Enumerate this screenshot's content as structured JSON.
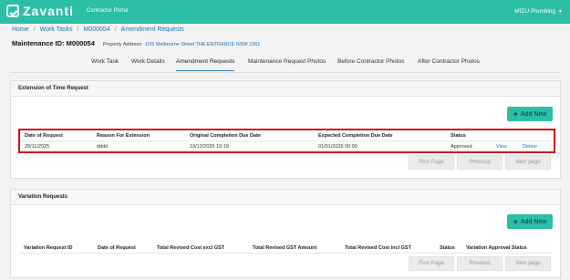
{
  "app": {
    "logo_text": "Zavanti",
    "portal_label": "Contractor Portal",
    "organisation": "MIZU Plumbing"
  },
  "breadcrumb": [
    "Home",
    "Work Tasks",
    "M000054",
    "Amendment Requests"
  ],
  "header": {
    "maintenance_id": "Maintenance ID: M000054",
    "address_label": "Property Address:",
    "address_value": "1/26 Melbourne Street THE ENTRANCE NSW 2261"
  },
  "tabs": [
    {
      "label": "Work Task",
      "active": false
    },
    {
      "label": "Work Details",
      "active": false
    },
    {
      "label": "Amendment Requests",
      "active": true
    },
    {
      "label": "Maintenance Request Photos",
      "active": false
    },
    {
      "label": "Before Contractor Photos",
      "active": false
    },
    {
      "label": "After Contractor Photos",
      "active": false
    }
  ],
  "extension": {
    "title": "Extension of Time Request",
    "add_label": "Add New",
    "columns": [
      "Date of Request",
      "Reason For Extension",
      "Original Completion Due Date",
      "Expected Completion Due Date",
      "Status"
    ],
    "rows": [
      {
        "date": "28/11/2025",
        "reason": "dddd",
        "original": "19/12/2025 19:19",
        "expected": "01/01/2026 00:00",
        "status": "Approved",
        "view": "View",
        "delete": "Delete"
      }
    ],
    "pager": {
      "first": "First Page",
      "previous": "Previous",
      "next": "Next page"
    }
  },
  "variation": {
    "title": "Variation Requests",
    "add_label": "Add New",
    "columns": [
      "Variation Request ID",
      "Date of Request",
      "Total Revised Cost excl GST",
      "Total Revised GST Amount",
      "Total Revised Cost incl GST",
      "Status",
      "Variation Approval Status"
    ],
    "pager": {
      "first": "First Page",
      "previous": "Previous",
      "next": "Next page"
    }
  },
  "colors": {
    "brand": "#2bbfa5",
    "link": "#1b6fb7",
    "highlight": "#d4141a"
  }
}
